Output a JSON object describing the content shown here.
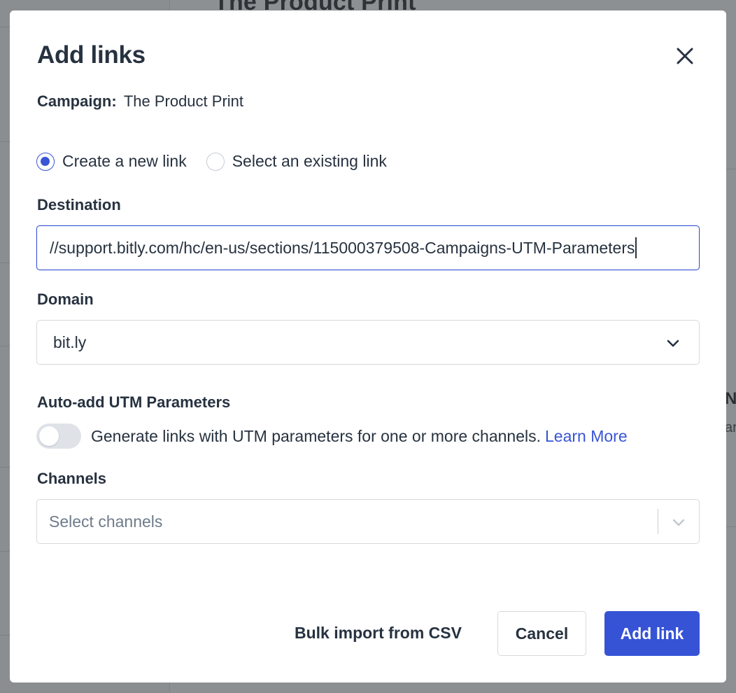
{
  "background": {
    "page_title": "The Product Print",
    "side_text_1": "NC",
    "side_text_2": "ar"
  },
  "modal": {
    "title": "Add links",
    "campaign_label": "Campaign:",
    "campaign_name": "The Product Print",
    "radio_options": [
      {
        "label": "Create a new link",
        "checked": true
      },
      {
        "label": "Select an existing link",
        "checked": false
      }
    ],
    "destination": {
      "label": "Destination",
      "value": "//support.bitly.com/hc/en-us/sections/115000379508-Campaigns-UTM-Parameters"
    },
    "domain": {
      "label": "Domain",
      "selected": "bit.ly"
    },
    "utm": {
      "label": "Auto-add UTM Parameters",
      "toggle_on": false,
      "description": "Generate links with UTM parameters for one or more channels.",
      "learn_more": "Learn More"
    },
    "channels": {
      "label": "Channels",
      "placeholder": "Select channels"
    },
    "footer": {
      "bulk_import": "Bulk import from CSV",
      "cancel": "Cancel",
      "add_link": "Add link"
    }
  },
  "colors": {
    "accent": "#3855d4",
    "primary_button": "#3653d6",
    "text": "#273240"
  }
}
